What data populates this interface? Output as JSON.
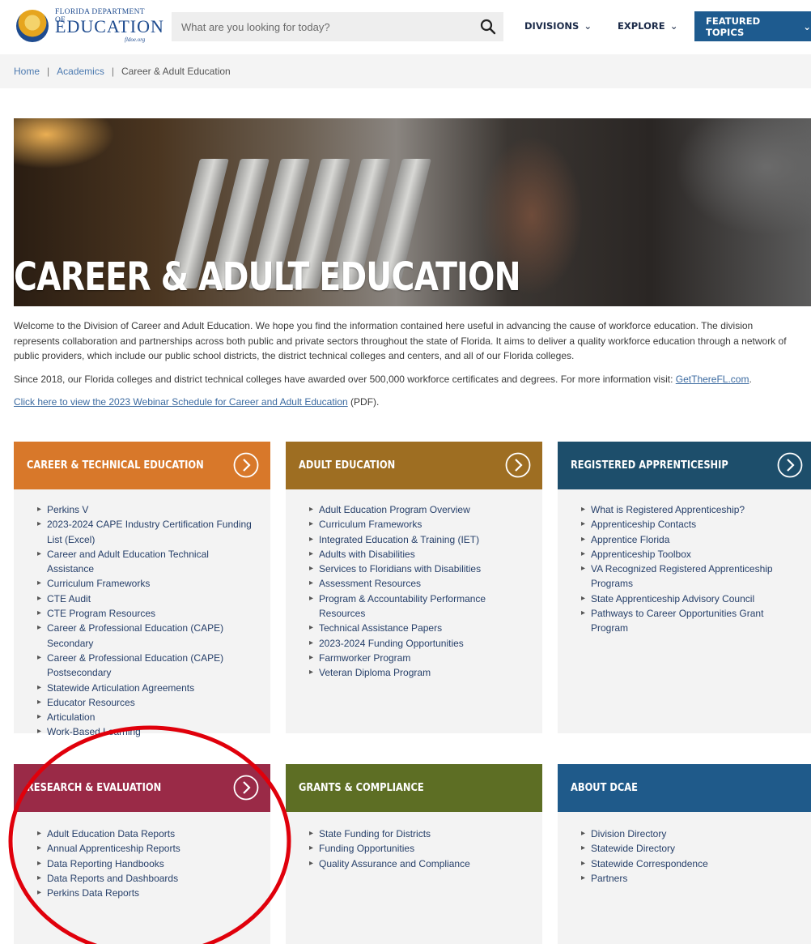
{
  "header": {
    "logo": {
      "line1": "FLORIDA DEPARTMENT OF",
      "line2": "EDUCATION",
      "line3": "fldoe.org"
    },
    "search": {
      "placeholder": "What are you looking for today?",
      "icon": "search-icon"
    },
    "nav": {
      "divisions": "DIVISIONS",
      "explore": "EXPLORE",
      "featured": "FEATURED TOPICS"
    }
  },
  "breadcrumb": [
    "Home",
    "Academics",
    "Career & Adult Education"
  ],
  "hero": {
    "title": "CAREER & ADULT EDUCATION"
  },
  "intro": {
    "p1": "Welcome to the Division of Career and Adult Education. We hope you find the information contained here useful in advancing the cause of workforce education. The division represents collaboration and partnerships across both public and private sectors throughout the state of Florida. It aims to deliver a quality workforce education through a network of public providers, which include our public school districts, the district technical colleges and centers, and all of our Florida colleges.",
    "p2_text": "Since 2018, our Florida colleges and district technical colleges have awarded over 500,000 workforce certificates and degrees. For more information visit: ",
    "p2_link": "GetThereFL.com",
    "p2_end": ".",
    "p3_link": "Click here to view the 2023 Webinar Schedule for Career and Adult Education",
    "p3_end": " (PDF)."
  },
  "cards": {
    "cte": {
      "title": "CAREER & TECHNICAL EDUCATION",
      "color": "#d8782a",
      "items": [
        "Perkins V",
        "2023-2024 CAPE Industry Certification Funding List (Excel)",
        "Career and Adult Education Technical Assistance",
        "Curriculum Frameworks",
        "CTE Audit",
        "CTE Program Resources",
        "Career & Professional Education (CAPE) Secondary",
        "Career & Professional Education (CAPE) Postsecondary",
        "Statewide Articulation Agreements",
        "Educator Resources",
        "Articulation",
        "Work-Based Learning"
      ]
    },
    "ae": {
      "title": "ADULT EDUCATION",
      "color": "#9e6e22",
      "items": [
        "Adult Education Program Overview",
        "Curriculum Frameworks",
        "Integrated Education & Training (IET)",
        "Adults with Disabilities",
        "Services to Floridians with Disabilities",
        "Assessment Resources",
        "Program & Accountability Performance Resources",
        "Technical Assistance Papers",
        "2023-2024 Funding Opportunities",
        "Farmworker Program",
        "Veteran Diploma Program"
      ]
    },
    "ra": {
      "title": "REGISTERED APPRENTICESHIP",
      "color": "#1d4e6b",
      "items": [
        "What is Registered Apprenticeship?",
        "Apprenticeship Contacts",
        "Apprentice Florida",
        "Apprenticeship Toolbox",
        "VA Recognized Registered Apprenticeship Programs",
        "State Apprenticeship Advisory Council",
        "Pathways to Career Opportunities Grant Program"
      ]
    },
    "re": {
      "title": "RESEARCH & EVALUATION",
      "color": "#9a2a47",
      "items": [
        "Adult Education Data Reports",
        "Annual Apprenticeship Reports",
        "Data Reporting Handbooks",
        "Data Reports and Dashboards",
        "Perkins Data Reports"
      ]
    },
    "gc": {
      "title": "GRANTS & COMPLIANCE",
      "color": "#5d6e24",
      "items": [
        "State Funding for Districts",
        "Funding Opportunities",
        "Quality Assurance and Compliance"
      ]
    },
    "ab": {
      "title": "ABOUT DCAE",
      "color": "#1f5a8a",
      "items": [
        "Division Directory",
        "Statewide Directory",
        "Statewide Correspondence",
        "Partners"
      ]
    }
  },
  "annotation_color": "#e0000b"
}
